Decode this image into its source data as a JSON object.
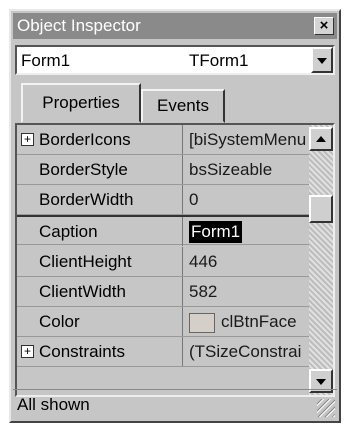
{
  "window": {
    "title": "Object Inspector"
  },
  "object_selector": {
    "name": "Form1",
    "type": "TForm1"
  },
  "tabs": [
    {
      "label": "Properties",
      "active": true
    },
    {
      "label": "Events",
      "active": false
    }
  ],
  "properties": [
    {
      "name": "BorderIcons",
      "value": "[biSystemMenu",
      "expandable": true,
      "expander": "+"
    },
    {
      "name": "BorderStyle",
      "value": "bsSizeable"
    },
    {
      "name": "BorderWidth",
      "value": "0"
    },
    {
      "name": "Caption",
      "value": "Form1",
      "selected": true
    },
    {
      "name": "ClientHeight",
      "value": "446"
    },
    {
      "name": "ClientWidth",
      "value": "582"
    },
    {
      "name": "Color",
      "value": "clBtnFace",
      "swatch_color": "#d4d0c8"
    },
    {
      "name": "Constraints",
      "value": "(TSizeConstrai",
      "expandable": true,
      "expander": "+"
    }
  ],
  "status": {
    "text": "All shown"
  },
  "icons": {
    "close": "close-icon",
    "dropdown": "chevron-down-icon",
    "scroll_up": "arrow-up-icon",
    "scroll_down": "arrow-down-icon",
    "resize": "resize-grip-icon"
  }
}
